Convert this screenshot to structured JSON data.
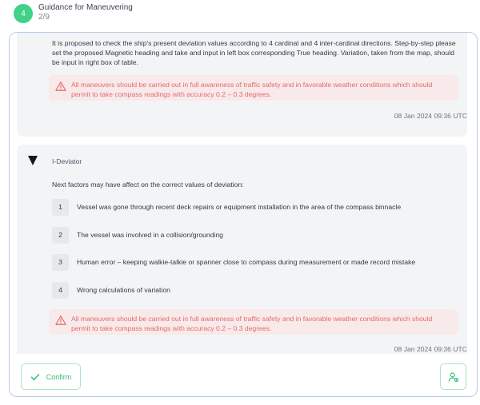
{
  "header": {
    "step_number": "4",
    "title": "Guidance for Maneuvering",
    "progress": "2/9"
  },
  "messages": [
    {
      "text": "It is proposed to check the ship's present deviation values according to 4 cardinal and 4 inter-cardinal directions. Step-by-step please set the proposed Magnetic heading and take and input in left box corresponding True heading. Variation, taken from the map, should be input in right box of table.",
      "warning": "All maneuvers should be carried out in full awareness of traffic safety and in favorable  weather conditions which should permit to take compass readings with accuracy 0.2 – 0.3 degrees.",
      "timestamp": "08 Jan 2024 09:36 UTC"
    },
    {
      "author": "I-Deviator",
      "intro": "Next factors may have affect on the correct values of deviation:",
      "factors": [
        {
          "num": "1",
          "text": "Vessel was gone through recent deck repairs or equipment installation in the area of the compass binnacle"
        },
        {
          "num": "2",
          "text": "The vessel was involved in a collision/grounding"
        },
        {
          "num": "3",
          "text": "Human error – keeping walkie-talkie or spanner close to compass during measurement or made record mistake"
        },
        {
          "num": "4",
          "text": "Wrong calculations of variation"
        }
      ],
      "warning": "All maneuvers should be carried out in full awareness of traffic safety and in favorable  weather conditions which should permit to take compass readings with accuracy 0.2 – 0.3 degrees.",
      "timestamp": "08 Jan 2024 09:36 UTC"
    }
  ],
  "footer": {
    "confirm_label": "Confirm"
  },
  "icons": {
    "warning": "warning-triangle-icon",
    "avatar": "deviator-chevron-icon",
    "confirm": "check-icon",
    "user": "user-add-icon"
  },
  "colors": {
    "accent": "#3fd288",
    "warning_text": "#e46a6a",
    "warning_bg": "#f8eaea",
    "frame_border": "#b7cde6"
  }
}
